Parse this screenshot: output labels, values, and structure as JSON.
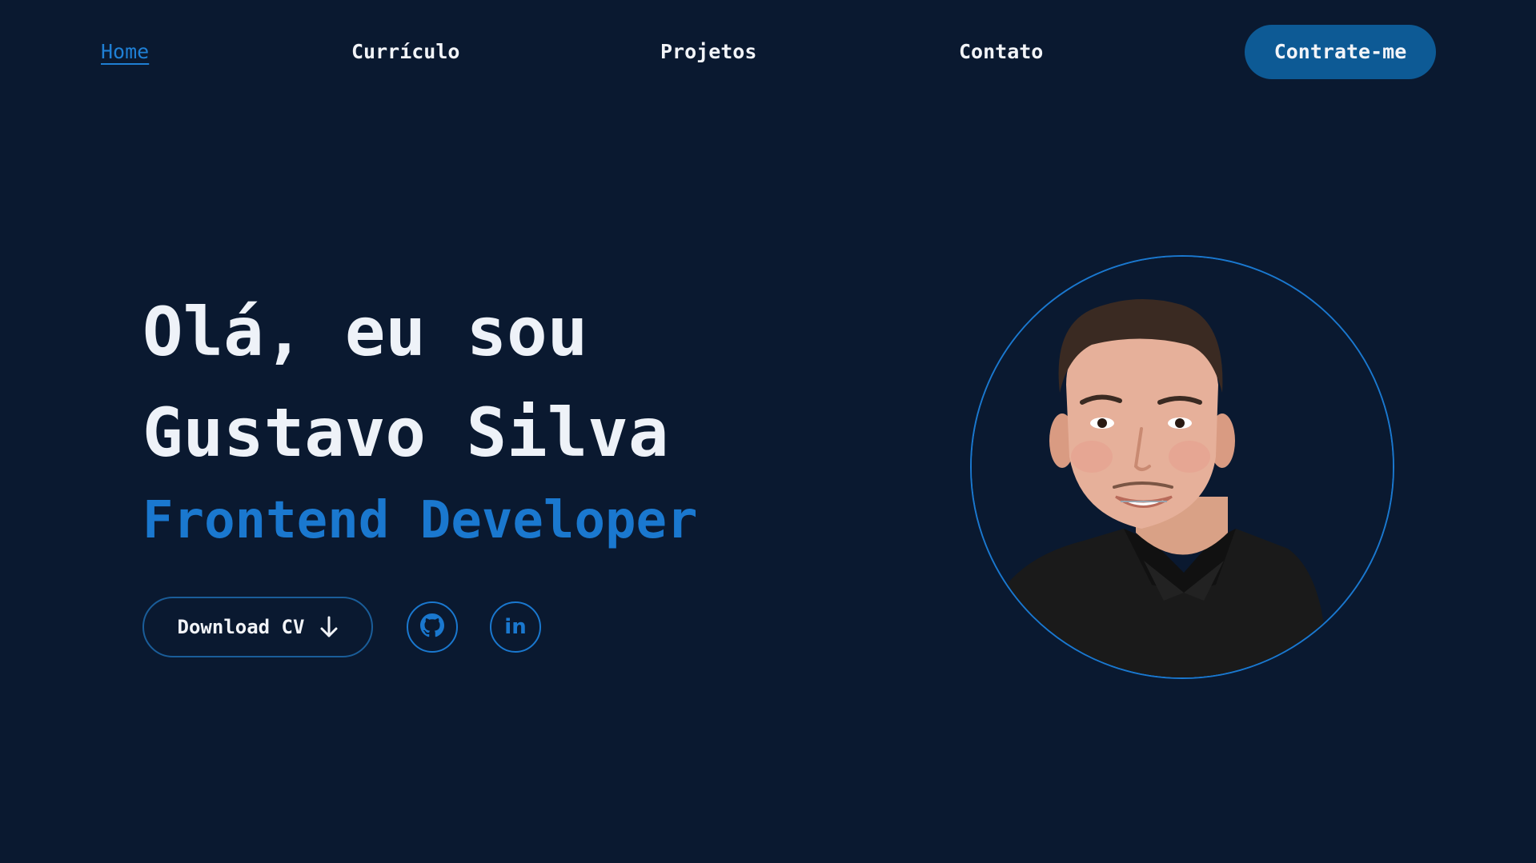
{
  "nav": {
    "links": [
      {
        "label": "Home",
        "active": true
      },
      {
        "label": "Currículo",
        "active": false
      },
      {
        "label": "Projetos",
        "active": false
      },
      {
        "label": "Contato",
        "active": false
      }
    ],
    "hire_button": "Contrate-me"
  },
  "hero": {
    "greeting_line1": "Olá, eu sou",
    "greeting_line2": "Gustavo Silva",
    "role": "Frontend Developer",
    "download_label": "Download CV",
    "social": [
      {
        "icon": "github-icon"
      },
      {
        "icon": "linkedin-icon",
        "text": "in"
      }
    ]
  },
  "colors": {
    "background": "#0a1930",
    "accent": "#1a78cf",
    "button": "#0d5a95",
    "text": "#f2f4f8"
  }
}
